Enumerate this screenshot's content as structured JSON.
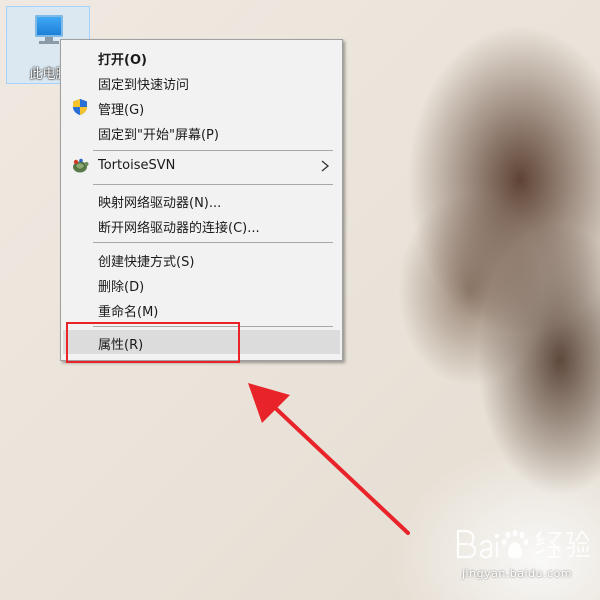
{
  "desktop": {
    "icon_label": "此电脑"
  },
  "context_menu": {
    "items": [
      {
        "label": "打开(O)",
        "bold": true,
        "icon": ""
      },
      {
        "label": "固定到快速访问",
        "icon": ""
      },
      {
        "label": "管理(G)",
        "icon": "admin-shield-icon"
      },
      {
        "label": "固定到\"开始\"屏幕(P)",
        "icon": ""
      },
      {
        "label": "TortoiseSVN",
        "icon": "tortoisesvn-icon",
        "has_submenu": true
      },
      {
        "label": "映射网络驱动器(N)...",
        "icon": ""
      },
      {
        "label": "断开网络驱动器的连接(C)...",
        "icon": ""
      },
      {
        "label": "创建快捷方式(S)",
        "icon": ""
      },
      {
        "label": "删除(D)",
        "icon": ""
      },
      {
        "label": "重命名(M)",
        "icon": ""
      },
      {
        "label": "属性(R)",
        "icon": "",
        "highlighted": true
      }
    ]
  },
  "annotation": {
    "color": "#e8242a"
  },
  "watermark": {
    "brand": "Bai经验",
    "url": "jingyan.baidu.com"
  }
}
